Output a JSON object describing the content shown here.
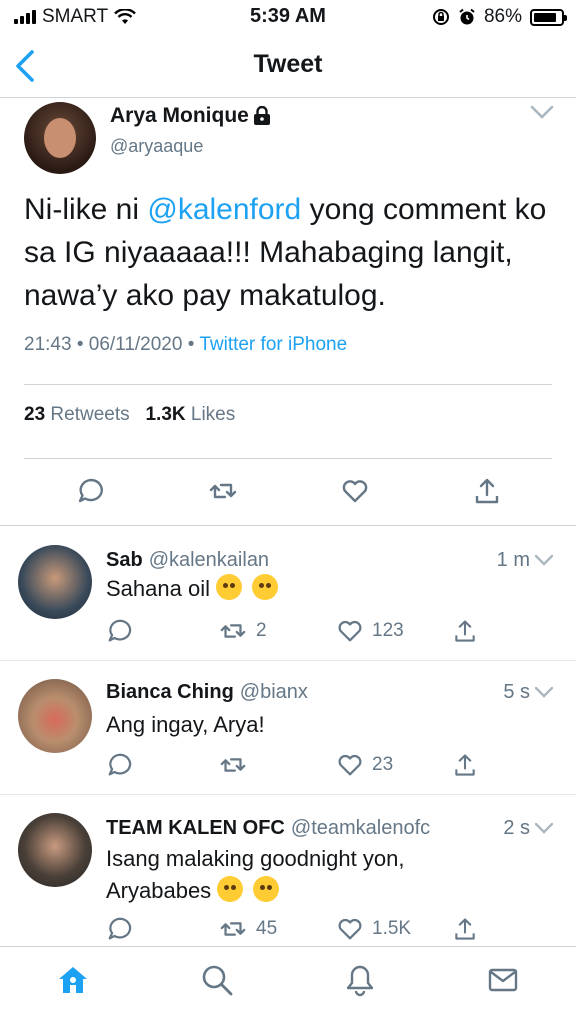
{
  "status_bar": {
    "carrier": "SMART",
    "time": "5:39 AM",
    "battery": "86%",
    "battery_level": 0.86
  },
  "nav": {
    "title": "Tweet"
  },
  "main_tweet": {
    "author_name": "Arya Monique",
    "author_handle": "@aryaaque",
    "text_before_mention": "Ni-like ni ",
    "mention": "@kalenford",
    "text_after_mention": " yong comment ko sa IG niyaaaaa!!! Mahabaging langit, nawa’y ako pay makatulog.",
    "timestamp": "21:43 • 06/11/2020 • ",
    "source": "Twitter for iPhone",
    "retweets_count": "23",
    "retweets_label": "Retweets",
    "likes_count": "1.3K",
    "likes_label": "Likes"
  },
  "replies": [
    {
      "name": "Sab",
      "handle": "@kalenkailan",
      "time": "1 m",
      "text": "Sahana oil",
      "retweets": "2",
      "likes": "123"
    },
    {
      "name": "Bianca Ching",
      "handle": "@bianx",
      "time": "5 s",
      "text": "Ang ingay, Arya!",
      "retweets": "",
      "likes": "23"
    },
    {
      "name": "TEAM KALEN OFC",
      "handle": "@teamkalenofc",
      "time": "2 s",
      "text_line1": "Isang malaking goodnight yon,",
      "text_line2": "Aryababes",
      "retweets": "45",
      "likes": "1.5K"
    }
  ],
  "tab_bar": {
    "items": [
      "home-icon",
      "search-icon",
      "notifications-icon",
      "messages-icon"
    ],
    "active": "home-icon"
  },
  "colors": {
    "accent": "#1da1f2",
    "muted": "#657786",
    "text": "#14171a",
    "divider": "#cfd4d8"
  }
}
